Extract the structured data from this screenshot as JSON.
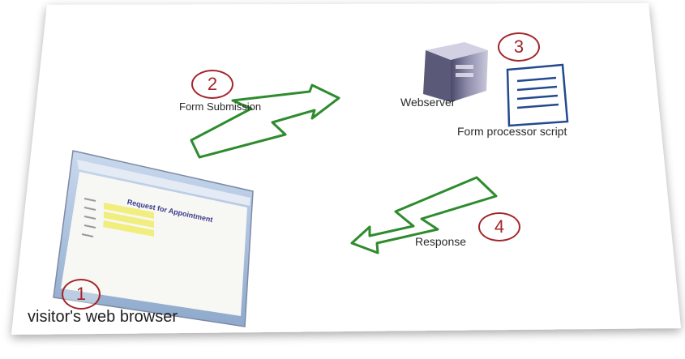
{
  "steps": {
    "browser": {
      "number": "1",
      "label": "visitor's web browser"
    },
    "submission": {
      "number": "2",
      "label": "Form Submission"
    },
    "server": {
      "number": "3",
      "label": "Webserver",
      "script_label": "Form processor script"
    },
    "response": {
      "number": "4",
      "label": "Response"
    }
  },
  "browser_window": {
    "form_heading": "Request for Appointment"
  },
  "colors": {
    "arrow_stroke": "#2e8b2e",
    "number_ring": "#a3262a",
    "paper": "#ffffff"
  },
  "icons": [
    "browser-window-icon",
    "server-tower-icon",
    "document-icon",
    "lightning-arrow-icon"
  ]
}
